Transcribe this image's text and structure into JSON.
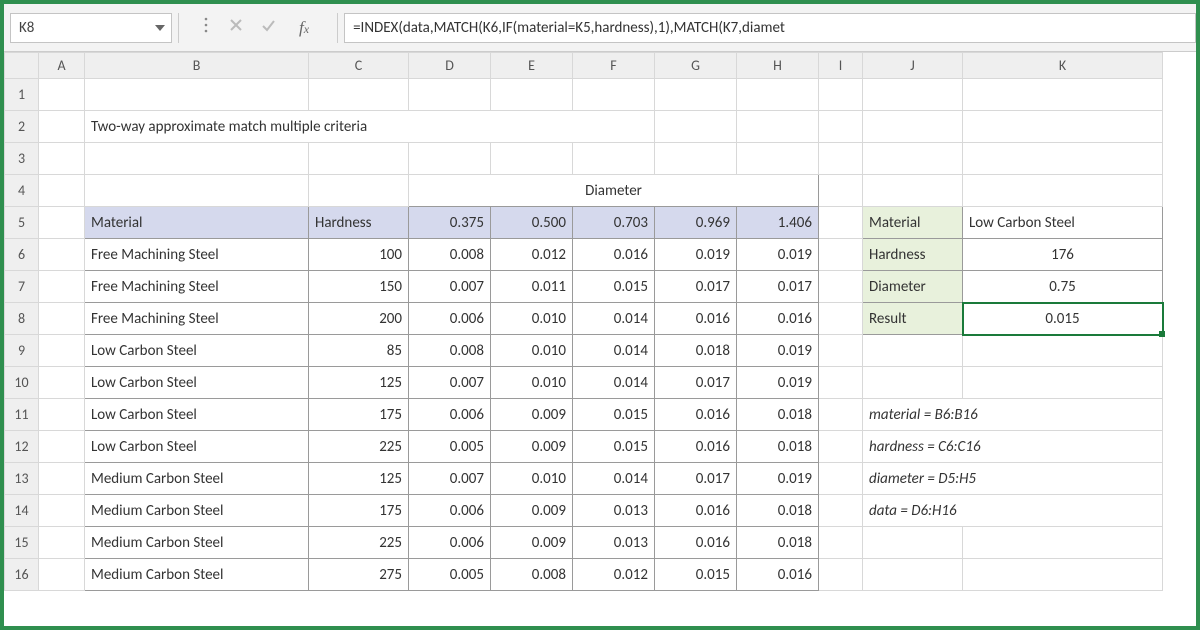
{
  "name_box": "K8",
  "formula": "=INDEX(data,MATCH(K6,IF(material=K5,hardness),1),MATCH(K7,diamet",
  "columns": [
    "A",
    "B",
    "C",
    "D",
    "E",
    "F",
    "G",
    "H",
    "I",
    "J",
    "K"
  ],
  "rows": [
    "1",
    "2",
    "3",
    "4",
    "5",
    "6",
    "7",
    "8",
    "9",
    "10",
    "11",
    "12",
    "13",
    "14",
    "15",
    "16"
  ],
  "title": "Two-way approximate match multiple criteria",
  "diameter_label": "Diameter",
  "headers": {
    "material": "Material",
    "hardness": "Hardness",
    "d1": "0.375",
    "d2": "0.500",
    "d3": "0.703",
    "d4": "0.969",
    "d5": "1.406"
  },
  "table": [
    {
      "mat": "Free Machining Steel",
      "h": "100",
      "d": [
        "0.008",
        "0.012",
        "0.016",
        "0.019",
        "0.019"
      ]
    },
    {
      "mat": "Free Machining Steel",
      "h": "150",
      "d": [
        "0.007",
        "0.011",
        "0.015",
        "0.017",
        "0.017"
      ]
    },
    {
      "mat": "Free Machining Steel",
      "h": "200",
      "d": [
        "0.006",
        "0.010",
        "0.014",
        "0.016",
        "0.016"
      ]
    },
    {
      "mat": "Low Carbon Steel",
      "h": "85",
      "d": [
        "0.008",
        "0.010",
        "0.014",
        "0.018",
        "0.019"
      ]
    },
    {
      "mat": "Low Carbon Steel",
      "h": "125",
      "d": [
        "0.007",
        "0.010",
        "0.014",
        "0.017",
        "0.019"
      ]
    },
    {
      "mat": "Low Carbon Steel",
      "h": "175",
      "d": [
        "0.006",
        "0.009",
        "0.015",
        "0.016",
        "0.018"
      ]
    },
    {
      "mat": "Low Carbon Steel",
      "h": "225",
      "d": [
        "0.005",
        "0.009",
        "0.015",
        "0.016",
        "0.018"
      ]
    },
    {
      "mat": "Medium Carbon Steel",
      "h": "125",
      "d": [
        "0.007",
        "0.010",
        "0.014",
        "0.017",
        "0.019"
      ]
    },
    {
      "mat": "Medium Carbon Steel",
      "h": "175",
      "d": [
        "0.006",
        "0.009",
        "0.013",
        "0.016",
        "0.018"
      ]
    },
    {
      "mat": "Medium Carbon Steel",
      "h": "225",
      "d": [
        "0.006",
        "0.009",
        "0.013",
        "0.016",
        "0.018"
      ]
    },
    {
      "mat": "Medium Carbon Steel",
      "h": "275",
      "d": [
        "0.005",
        "0.008",
        "0.012",
        "0.015",
        "0.016"
      ]
    }
  ],
  "lookup": {
    "material_label": "Material",
    "material_val": "Low Carbon Steel",
    "hardness_label": "Hardness",
    "hardness_val": "176",
    "diameter_label": "Diameter",
    "diameter_val": "0.75",
    "result_label": "Result",
    "result_val": "0.015"
  },
  "names": {
    "n1": "material = B6:B16",
    "n2": "hardness = C6:C16",
    "n3": "diameter = D5:H5",
    "n4": "data = D6:H16"
  }
}
